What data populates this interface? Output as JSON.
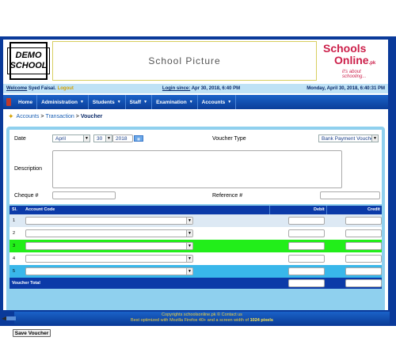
{
  "header": {
    "logo_line1": "DEMO",
    "logo_line2": "SCHOOL",
    "picture_placeholder": "School Picture",
    "brand_line1": "Schools",
    "brand_line2": "Online",
    "brand_suffix": ".pk",
    "brand_tagline": "it's about schooling..."
  },
  "status": {
    "welcome_label": "Welcome",
    "user": "Syed Faisal.",
    "logout": "Logout",
    "login_label": "Login since:",
    "login_value": "Apr 30, 2018, 6:40 PM",
    "current_datetime": "Monday, April 30, 2018, 6:40:31 PM"
  },
  "nav": {
    "items": [
      "Home",
      "Administration",
      "Students",
      "Staff",
      "Examination",
      "Accounts"
    ]
  },
  "breadcrumb": {
    "items": [
      "Accounts",
      "Transaction"
    ],
    "current": "Voucher"
  },
  "form": {
    "date_label": "Date",
    "month": "April",
    "day": "30",
    "year": "2018",
    "voucher_type_label": "Voucher Type",
    "voucher_type_value": "Bank Payment Voucher",
    "description_label": "Description",
    "cheque_label": "Cheque #",
    "reference_label": "Reference #"
  },
  "table": {
    "headers": {
      "sl": "Sl.",
      "account": "Account Code",
      "debit": "Debit",
      "credit": "Credit"
    },
    "rows": [
      "1",
      "2",
      "3",
      "4",
      "5"
    ],
    "total_label": "Voucher Total"
  },
  "actions": {
    "save_label": "Save Voucher"
  },
  "footer": {
    "line1": "Copyrights schoolsonline.pk © Contact us",
    "line2_prefix": "Best optimized with Mozilla Firefox 40+ and a screen width of",
    "line2_strong": "1024 pixels"
  },
  "colors": {
    "primary": "#0b3aa8",
    "panel": "#8fd0ee",
    "highlight_row": "#22ee1a",
    "accent_row": "#39b7ea"
  }
}
